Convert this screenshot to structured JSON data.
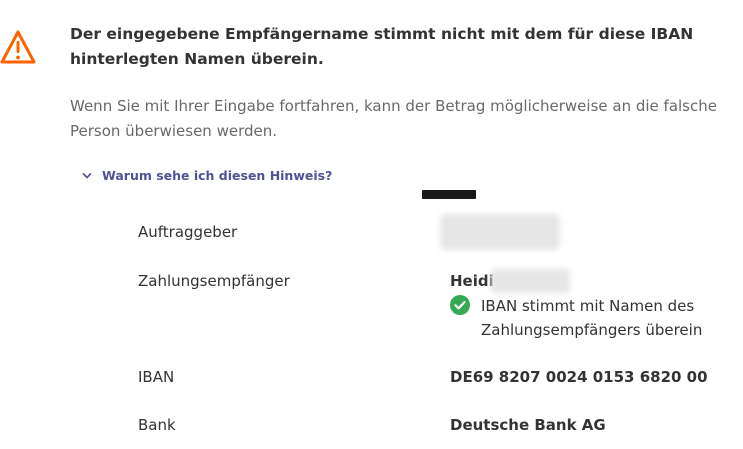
{
  "warning": {
    "icon": "warning-triangle-icon",
    "icon_color": "#ff6200",
    "headline": "Der eingegebene Empfängername stimmt nicht mit dem für diese IBAN hinterlegten Namen überein.",
    "subtext": "Wenn Sie mit Ihrer Eingabe fortfahren, kann der Betrag möglicherweise an die falsche Person überwiesen werden."
  },
  "details_toggle": {
    "icon": "chevron-down-icon",
    "label": "Warum sehe ich diesen Hinweis?",
    "color": "#525199"
  },
  "details": {
    "ordering_party": {
      "label": "Auftraggeber"
    },
    "payee": {
      "label": "Zahlungsempfänger",
      "value_visible": "Heidi",
      "match_icon": "check-circle-icon",
      "match_color": "#34a853",
      "match_text": "IBAN stimmt mit Namen des Zahlungsempfängers überein"
    },
    "iban": {
      "label": "IBAN",
      "value": "DE69 8207 0024 0153 6820 00"
    },
    "bank": {
      "label": "Bank",
      "value": "Deutsche Bank AG"
    }
  }
}
